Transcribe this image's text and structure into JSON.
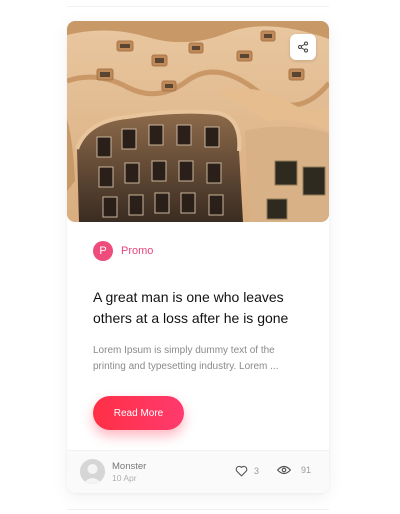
{
  "card": {
    "image": {
      "alt": "Casa Mila courtyard",
      "share_icon": "share-icon"
    },
    "category": {
      "initial": "P",
      "label": "Promo",
      "color": "#ee4d7b"
    },
    "title": "A great man is one who leaves others at a loss after he is gone",
    "excerpt": "Lorem Ipsum is simply dummy text of the printing and typesetting industry. Lorem ...",
    "read_more_label": "Read More",
    "footer": {
      "author_name": "Monster",
      "date": "10 Apr",
      "likes": "3",
      "views": "91",
      "like_icon": "heart-icon",
      "view_icon": "eye-icon"
    }
  },
  "colors": {
    "accent": "#ff2f45",
    "accent_end": "#ff3a6d",
    "category": "#e8457a",
    "title": "#111111",
    "muted": "#8a8a8a"
  }
}
